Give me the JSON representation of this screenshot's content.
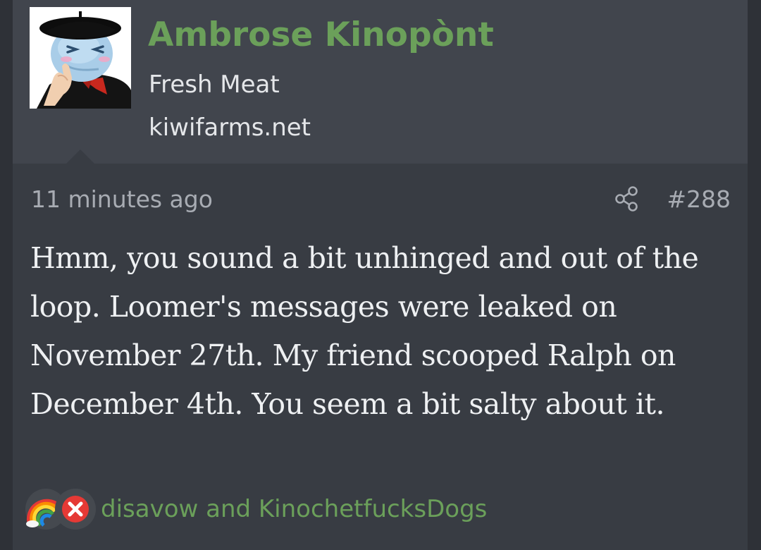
{
  "post": {
    "author": {
      "name": "Ambrose Kinopònt",
      "title": "Fresh Meat",
      "site": "kiwifarms.net",
      "avatar_icon": "beret-avatar-icon"
    },
    "timestamp": "11 minutes ago",
    "post_number": "#288",
    "message": "Hmm, you sound a bit unhinged and out of the loop. Loomer's messages were leaked on November 27th. My friend scooped Ralph on December 4th. You seem a bit salty about it.",
    "reactions": {
      "icons": [
        "rainbow-icon",
        "disavow-x-icon"
      ],
      "users_text": "disavow and KinochetfucksDogs"
    }
  },
  "colors": {
    "page_background": "#2e3137",
    "post_background": "#383c43",
    "header_background": "#41454d",
    "username": "#6ba05a",
    "reaction_text": "#6ba05a",
    "meta_text": "#a8acb3",
    "message_text": "#eef0f2",
    "disavow_red": "#e53935"
  }
}
